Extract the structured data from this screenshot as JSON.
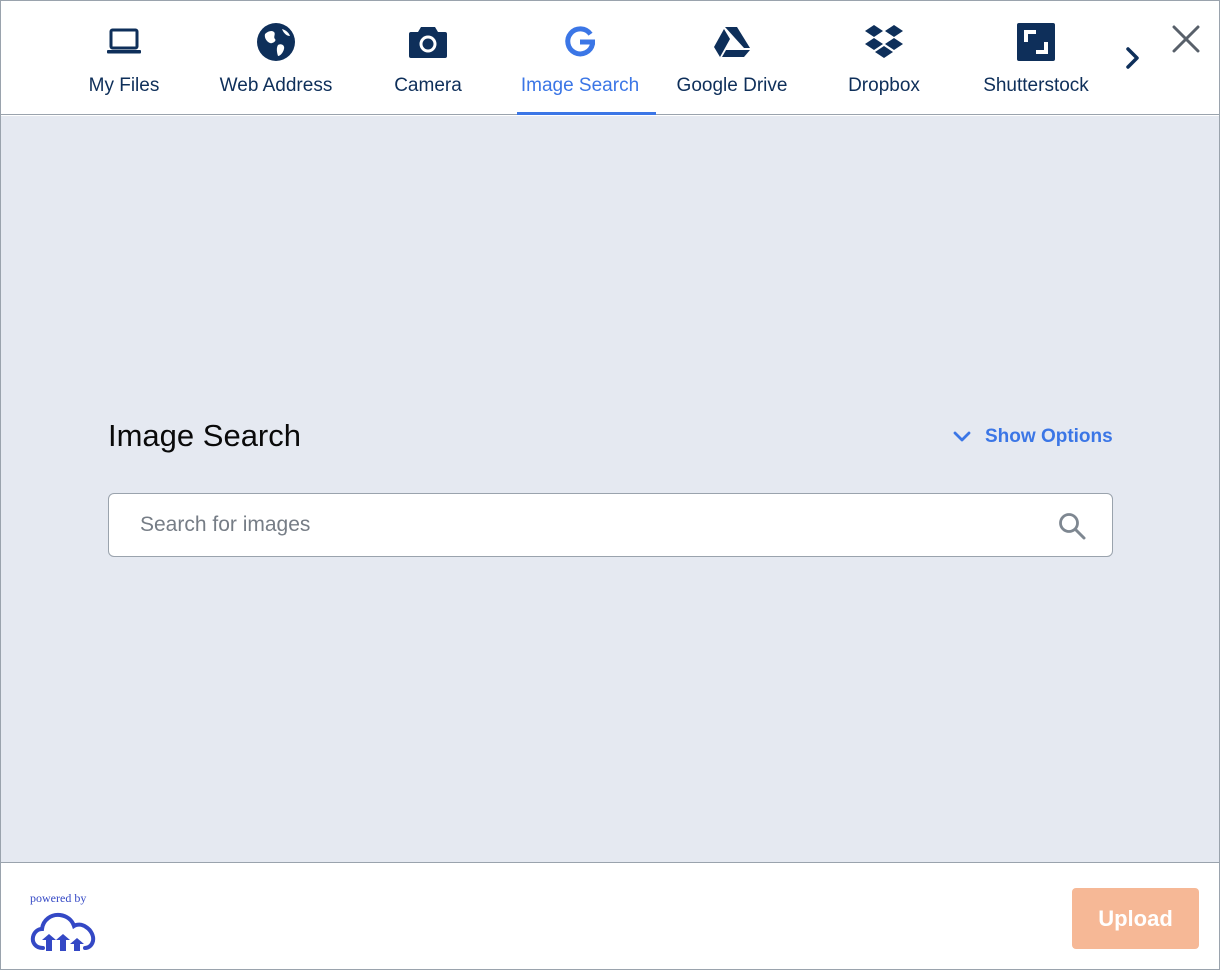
{
  "header": {
    "tabs": [
      {
        "id": "my-files",
        "label": "My Files",
        "icon": "laptop-icon"
      },
      {
        "id": "web-address",
        "label": "Web Address",
        "icon": "globe-icon"
      },
      {
        "id": "camera",
        "label": "Camera",
        "icon": "camera-icon"
      },
      {
        "id": "image-search",
        "label": "Image Search",
        "icon": "google-icon",
        "active": true
      },
      {
        "id": "google-drive",
        "label": "Google Drive",
        "icon": "google-drive-icon"
      },
      {
        "id": "dropbox",
        "label": "Dropbox",
        "icon": "dropbox-icon"
      },
      {
        "id": "shutterstock",
        "label": "Shutterstock",
        "icon": "shutterstock-icon"
      }
    ],
    "next_icon": "chevron-right-icon",
    "close_icon": "close-icon"
  },
  "main": {
    "title": "Image Search",
    "show_options_label": "Show Options",
    "search": {
      "placeholder": "Search for images",
      "value": ""
    }
  },
  "footer": {
    "powered_by": "powered by",
    "brand_icon": "cloudinary-logo-icon",
    "upload_label": "Upload"
  },
  "colors": {
    "navy": "#0e2f5a",
    "accent_blue": "#3b76e6",
    "content_bg": "#e5e9f1",
    "upload_disabled": "#f6b896",
    "brand_blue": "#3448c5"
  }
}
